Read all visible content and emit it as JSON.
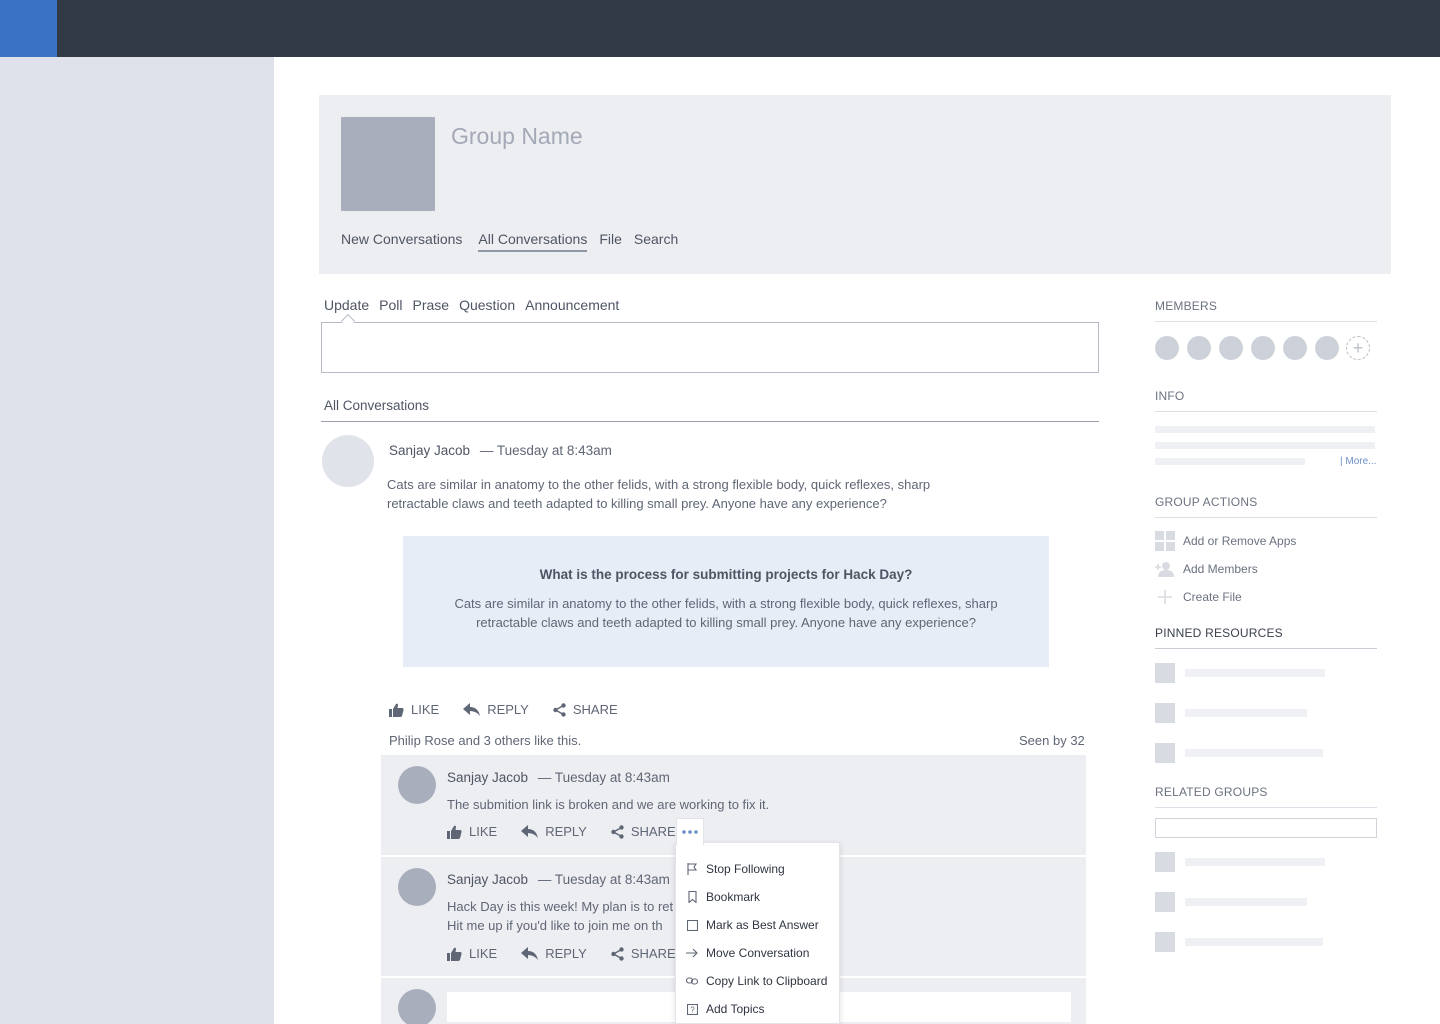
{
  "group": {
    "name": "Group Name",
    "tabs": [
      "New Conversations",
      "All Conversations",
      "File",
      "Search"
    ],
    "active_tab": "All Conversations"
  },
  "composer": {
    "tabs": [
      "Update",
      "Poll",
      "Prase",
      "Question",
      "Announcement"
    ],
    "active_tab": "Update"
  },
  "feed": {
    "section_title": "All Conversations",
    "post": {
      "author": "Sanjay Jacob",
      "time": "— Tuesday at 8:43am",
      "body": "Cats are similar in anatomy to the other felids, with a strong flexible body, quick reflexes, sharp retractable claws and teeth adapted to killing small prey.  Anyone have any experience?",
      "quote": {
        "title": "What is the process for submitting projects for Hack Day?",
        "body": "Cats are similar in anatomy to the other felids, with a strong flexible body, quick reflexes, sharp retractable claws and teeth adapted to killing small prey.  Anyone have any experience?"
      },
      "actions": {
        "like": "LIKE",
        "reply": "REPLY",
        "share": "SHARE"
      },
      "likes_text": "Philip Rose and 3 others like this.",
      "seen_by": "Seen by 32"
    },
    "replies": [
      {
        "author": "Sanjay Jacob",
        "time": "— Tuesday at 8:43am",
        "body": "The submition link is broken and we are working to fix it."
      },
      {
        "author": "Sanjay Jacob",
        "time": "— Tuesday at 8:43am",
        "body_line1": "Hack Day is this week! My plan is to ret",
        "body_line2": "Hit me up if you'd like to join me on th"
      }
    ]
  },
  "menu": {
    "items": [
      {
        "label": "Stop Following",
        "icon": "flag-icon"
      },
      {
        "label": "Bookmark",
        "icon": "bookmark-icon"
      },
      {
        "label": "Mark as Best Answer",
        "icon": "checkbox-icon"
      },
      {
        "label": "Move Conversation",
        "icon": "arrow-right-icon"
      },
      {
        "label": "Copy Link to Clipboard",
        "icon": "link-icon"
      },
      {
        "label": "Add Topics",
        "icon": "topic-icon"
      }
    ]
  },
  "sidebar": {
    "members_title": "MEMBERS",
    "info_title": "INFO",
    "info_more": "| More...",
    "group_actions_title": "GROUP ACTIONS",
    "group_actions": [
      "Add or Remove Apps",
      "Add Members",
      "Create File"
    ],
    "pinned_title": "PINNED RESOURCES",
    "related_title": "RELATED GROUPS"
  }
}
